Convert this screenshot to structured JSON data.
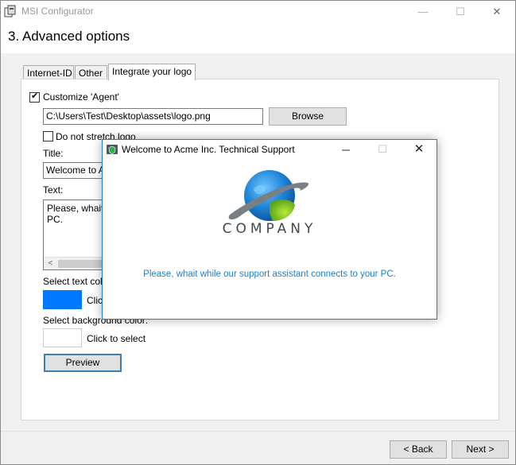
{
  "window": {
    "title": "MSI Configurator",
    "page_title": "3. Advanced options",
    "minimize": "—",
    "maximize": "☐",
    "close": "✕"
  },
  "tabs": [
    {
      "label": "Internet-ID",
      "active": false
    },
    {
      "label": "Other",
      "active": false
    },
    {
      "label": "Integrate your logo",
      "active": true
    }
  ],
  "form": {
    "customize_label": "Customize 'Agent'",
    "customize_checked": true,
    "logo_path": "C:\\Users\\Test\\Desktop\\assets\\logo.png",
    "browse_label": "Browse",
    "no_stretch_label": "Do not stretch logo",
    "no_stretch_checked": false,
    "title_label": "Title:",
    "title_value": "Welcome to Acme Inc. Technical Support",
    "text_label": "Text:",
    "text_value": "Please, whait while our support assistant connects to your PC.",
    "scroll_left": "<",
    "text_color_label": "Select text color:",
    "text_color": "#0078ff",
    "text_color_action": "Click to select",
    "bg_color_label": "Select background color:",
    "bg_color": "#ffffff",
    "bg_color_action": "Click to select",
    "preview_label": "Preview"
  },
  "footer": {
    "back_label": "< Back",
    "next_label": "Next >"
  },
  "preview_dialog": {
    "title": "Welcome to Acme Inc. Technical Support",
    "maximize": "☐",
    "close": "✕",
    "logo_text": "COMPANY",
    "message": "Please, whait while our support assistant connects to your PC."
  },
  "colors": {
    "accent": "#1883d7",
    "message_text": "#1e7fc9"
  }
}
